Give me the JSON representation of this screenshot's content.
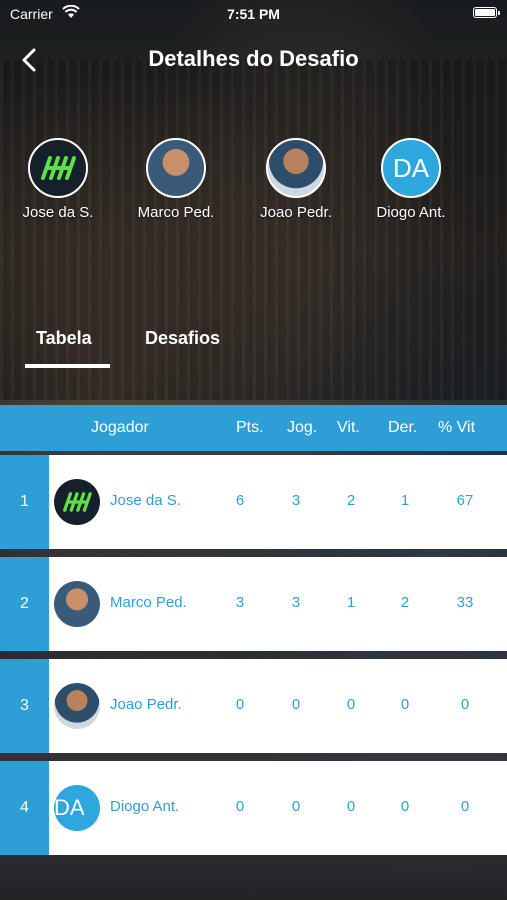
{
  "status_bar": {
    "carrier": "Carrier",
    "time": "7:51 PM"
  },
  "header": {
    "title": "Detalhes do Desafio"
  },
  "players": [
    {
      "name": "Jose da S.",
      "avatar": "logo"
    },
    {
      "name": "Marco Ped.",
      "avatar": "photo"
    },
    {
      "name": "Joao Pedr.",
      "avatar": "photo"
    },
    {
      "name": "Diogo Ant.",
      "avatar": "initials",
      "initials": "DA"
    }
  ],
  "tabs": [
    {
      "label": "Tabela",
      "active": true
    },
    {
      "label": "Desafios",
      "active": false
    }
  ],
  "table": {
    "columns": [
      "Jogador",
      "Pts.",
      "Jog.",
      "Vit.",
      "Der.",
      "% Vit"
    ],
    "rows": [
      {
        "rank": "1",
        "name": "Jose da S.",
        "pts": "6",
        "jog": "3",
        "vit": "2",
        "der": "1",
        "pct": "67"
      },
      {
        "rank": "2",
        "name": "Marco Ped.",
        "pts": "3",
        "jog": "3",
        "vit": "1",
        "der": "2",
        "pct": "33"
      },
      {
        "rank": "3",
        "name": "Joao Pedr.",
        "pts": "0",
        "jog": "0",
        "vit": "0",
        "der": "0",
        "pct": "0"
      },
      {
        "rank": "4",
        "name": "Diogo Ant.",
        "pts": "0",
        "jog": "0",
        "vit": "0",
        "der": "0",
        "pct": "0",
        "initials": "DA"
      }
    ]
  },
  "colors": {
    "accent": "#2e9fd6",
    "logo_green": "#5de04a"
  }
}
